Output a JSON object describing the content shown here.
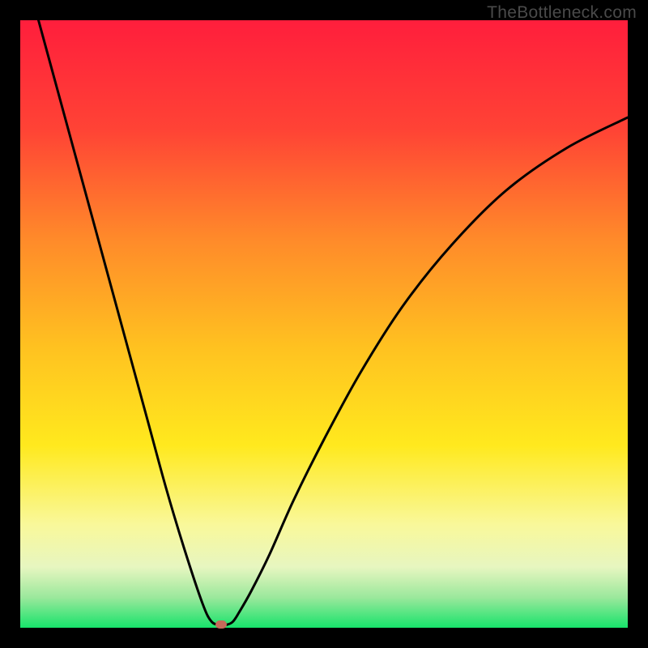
{
  "watermark": "TheBottleneck.com",
  "chart_data": {
    "type": "line",
    "title": "",
    "xlabel": "",
    "ylabel": "",
    "xlim": [
      0,
      100
    ],
    "ylim": [
      0,
      100
    ],
    "gradient_stops": [
      {
        "offset": 0,
        "color": "#ff1e3c"
      },
      {
        "offset": 18,
        "color": "#ff4335"
      },
      {
        "offset": 36,
        "color": "#ff8a2a"
      },
      {
        "offset": 54,
        "color": "#ffc220"
      },
      {
        "offset": 70,
        "color": "#ffe91e"
      },
      {
        "offset": 83,
        "color": "#f9f89a"
      },
      {
        "offset": 90,
        "color": "#e7f6c0"
      },
      {
        "offset": 95,
        "color": "#9be89c"
      },
      {
        "offset": 100,
        "color": "#17e36b"
      }
    ],
    "series": [
      {
        "name": "bottleneck-curve",
        "x": [
          3,
          6,
          9,
          12,
          15,
          18,
          21,
          24,
          27,
          30,
          31.5,
          33,
          34,
          35,
          36,
          38,
          41,
          45,
          50,
          56,
          63,
          71,
          80,
          90,
          100
        ],
        "y": [
          100,
          89,
          78,
          67,
          56,
          45,
          34,
          23,
          13,
          4,
          1,
          0.5,
          0.5,
          1,
          2.5,
          6,
          12,
          21,
          31,
          42,
          53,
          63,
          72,
          79,
          84
        ]
      }
    ],
    "marker": {
      "x": 33,
      "y": 0.5,
      "color": "#c56a5a"
    }
  }
}
